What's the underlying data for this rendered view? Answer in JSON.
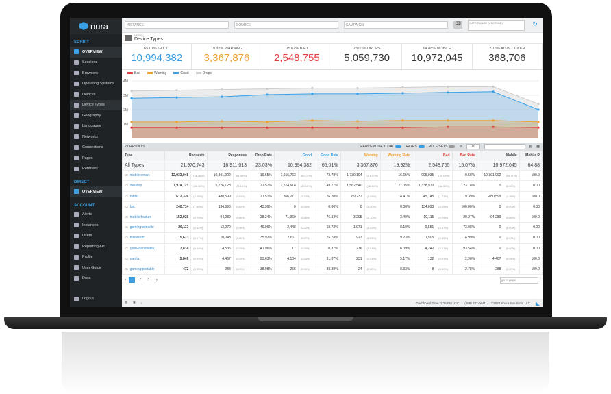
{
  "logo": {
    "text": "nura"
  },
  "sidebar": {
    "script_label": "SCRIPT",
    "script_items": [
      {
        "label": "OVERVIEW",
        "icon": "dashboard-icon",
        "active": true
      },
      {
        "label": "Sessions",
        "icon": "sessions-icon"
      },
      {
        "label": "Browsers",
        "icon": "browser-icon"
      },
      {
        "label": "Operating Systems",
        "icon": "os-icon"
      },
      {
        "label": "Devices",
        "icon": "devices-icon"
      },
      {
        "label": "Device Types",
        "icon": "device-types-icon",
        "selected": true
      },
      {
        "label": "Geography",
        "icon": "globe-icon"
      },
      {
        "label": "Languages",
        "icon": "language-icon"
      },
      {
        "label": "Networks",
        "icon": "network-icon"
      },
      {
        "label": "Connections",
        "icon": "connections-icon"
      },
      {
        "label": "Pages",
        "icon": "pages-icon"
      },
      {
        "label": "Referrers",
        "icon": "referrers-icon"
      }
    ],
    "direct_label": "DIRECT",
    "direct_items": [
      {
        "label": "OVERVIEW",
        "icon": "dashboard-icon",
        "active": true
      }
    ],
    "account_label": "ACCOUNT",
    "account_items": [
      {
        "label": "Alerts",
        "icon": "alerts-icon"
      },
      {
        "label": "Instances",
        "icon": "instances-icon"
      },
      {
        "label": "Users",
        "icon": "users-icon"
      },
      {
        "label": "Reporting API",
        "icon": "api-icon"
      },
      {
        "label": "Profile",
        "icon": "profile-icon"
      },
      {
        "label": "User Guide",
        "icon": "guide-icon"
      },
      {
        "label": "Docs",
        "icon": "docs-icon"
      }
    ],
    "logout": "Logout"
  },
  "filters": {
    "instance": "INSTANCE",
    "source": "SOURCE",
    "campaign": "CAMPAIGN",
    "daterange": "DATE RANGE (UTC TIME)"
  },
  "header": {
    "small": "METRIC",
    "title": "Device Types"
  },
  "stats": [
    {
      "label": "65.01% GOOD",
      "value": "10,994,382",
      "color": "c-good"
    },
    {
      "label": "19.92% WARNING",
      "value": "3,367,876",
      "color": "c-warn"
    },
    {
      "label": "15.07% BAD",
      "value": "2,548,755",
      "color": "c-bad"
    },
    {
      "label": "23.03% DROPS",
      "value": "5,059,730",
      "color": "c-dark"
    },
    {
      "label": "64.88% MOBILE",
      "value": "10,972,045",
      "color": "c-dark"
    },
    {
      "label": "2.18% AD BLOCKER",
      "value": "368,706",
      "color": "c-dark"
    }
  ],
  "legend": [
    {
      "name": "Bad",
      "color": "#e04040"
    },
    {
      "name": "Warning",
      "color": "#f0a030"
    },
    {
      "name": "Good",
      "color": "#3aa0e6"
    },
    {
      "name": "Drops",
      "color": "#cccccc"
    }
  ],
  "chart_data": {
    "type": "area",
    "yticks": [
      "4M",
      "3M",
      "2M",
      "1M"
    ],
    "ylim": [
      0,
      4000000
    ],
    "series": [
      {
        "name": "Drops",
        "color": "#cccccc",
        "values": [
          3300000,
          3350000,
          3400000,
          3450000,
          3500000,
          3500000,
          3550000,
          3600000,
          3600000,
          2400000
        ]
      },
      {
        "name": "Good",
        "color": "#3aa0e6",
        "values": [
          2800000,
          2850000,
          2900000,
          3050000,
          3100000,
          3100000,
          3150000,
          3200000,
          3250000,
          2000000
        ]
      },
      {
        "name": "Warning",
        "color": "#f0a030",
        "values": [
          1150000,
          1150000,
          1200000,
          1150000,
          1250000,
          1200000,
          1250000,
          1250000,
          1250000,
          1150000
        ]
      },
      {
        "name": "Bad",
        "color": "#e04040",
        "values": [
          750000,
          750000,
          750000,
          750000,
          750000,
          750000,
          750000,
          800000,
          800000,
          750000
        ]
      }
    ]
  },
  "toolbar": {
    "results": "21 RESULTS",
    "percent": "PERCENT OF TOTAL",
    "rates": "RATES",
    "rulesets": "RULE SETS",
    "pagesize": "10"
  },
  "table": {
    "headers": [
      "Type",
      "Requests",
      "Responses",
      "Drop Rate",
      "Good",
      "Good Rate",
      "Warning",
      "Warning Rate",
      "Bad",
      "Bad Rate",
      "Mobile",
      "Mobile R"
    ],
    "all": [
      "All Types",
      "21,970,743",
      "16,911,013",
      "23.03%",
      "10,994,382",
      "65.01%",
      "3,367,876",
      "19.92%",
      "2,548,755",
      "15.07%",
      "10,972,045",
      "64.88"
    ],
    "rows": [
      {
        "icon": "mobile-icon",
        "name": "mobile:smart",
        "req": "12,933,048",
        "reqp": "(58.86%)",
        "resp": "10,391,992",
        "respp": "(61.45%)",
        "drop": "19.65%",
        "good": "7,666,763",
        "goodp": "(69.73%)",
        "goodr": "73.78%",
        "warn": "1,730,194",
        "warnp": "(51.37%)",
        "warnr": "16.65%",
        "bad": "995,035",
        "badp": "(39.04%)",
        "badr": "9.58%",
        "mob": "10,391,992",
        "mobp": "(94.71%)",
        "mobr": "100.0"
      },
      {
        "icon": "desktop-icon",
        "name": "desktop",
        "req": "7,974,721",
        "reqp": "(36.30%)",
        "resp": "5,776,128",
        "respp": "(34.16%)",
        "drop": "27.57%",
        "good": "2,874,618",
        "goodp": "(26.15%)",
        "goodr": "49.77%",
        "warn": "1,562,540",
        "warnp": "(46.40%)",
        "warnr": "27.05%",
        "bad": "1,338,970",
        "badp": "(52.53%)",
        "badr": "23.18%",
        "mob": "0",
        "mobp": "(0.00%)",
        "mobr": "0.00"
      },
      {
        "icon": "tablet-icon",
        "name": "tablet",
        "req": "612,326",
        "reqp": "(2.79%)",
        "resp": "480,599",
        "respp": "(2.84%)",
        "drop": "21.51%",
        "good": "366,217",
        "goodp": "(3.33%)",
        "goodr": "76.20%",
        "warn": "69,237",
        "warnp": "(2.06%)",
        "warnr": "14.41%",
        "bad": "45,145",
        "badp": "(1.77%)",
        "badr": "9.39%",
        "mob": "480,599",
        "mobp": "(4.38%)",
        "mobr": "100.0"
      },
      {
        "icon": "bot-icon",
        "name": "bot",
        "req": "240,714",
        "reqp": "(1.10%)",
        "resp": "134,893",
        "respp": "(0.80%)",
        "drop": "43.96%",
        "good": "0",
        "goodp": "(0.00%)",
        "goodr": "0.00%",
        "warn": "0",
        "warnp": "(0.00%)",
        "warnr": "0.00%",
        "bad": "134,893",
        "badp": "(5.29%)",
        "badr": "100.00%",
        "mob": "0",
        "mobp": "(0.00%)",
        "mobr": "0.00"
      },
      {
        "icon": "mobile-icon",
        "name": "mobile:feature",
        "req": "152,928",
        "reqp": "(0.70%)",
        "resp": "94,289",
        "respp": "(0.56%)",
        "drop": "38.34%",
        "good": "71,969",
        "goodp": "(0.65%)",
        "goodr": "76.33%",
        "warn": "3,205",
        "warnp": "(0.10%)",
        "warnr": "3.40%",
        "bad": "19,115",
        "badp": "(0.75%)",
        "badr": "20.27%",
        "mob": "94,289",
        "mobp": "(0.86%)",
        "mobr": "100.0"
      },
      {
        "icon": "gamepad-icon",
        "name": "gaming:console",
        "req": "26,117",
        "reqp": "(0.12%)",
        "resp": "13,070",
        "respp": "(0.08%)",
        "drop": "49.96%",
        "good": "2,448",
        "goodp": "(0.02%)",
        "goodr": "18.73%",
        "warn": "1,071",
        "warnp": "(0.03%)",
        "warnr": "8.19%",
        "bad": "9,551",
        "badp": "(0.37%)",
        "badr": "73.08%",
        "mob": "0",
        "mobp": "(0.00%)",
        "mobr": "0.00"
      },
      {
        "icon": "tv-icon",
        "name": "television",
        "req": "15,673",
        "reqp": "(0.07%)",
        "resp": "10,043",
        "respp": "(0.06%)",
        "drop": "35.92%",
        "good": "7,611",
        "goodp": "(0.07%)",
        "goodr": "75.78%",
        "warn": "927",
        "warnp": "(0.03%)",
        "warnr": "9.23%",
        "bad": "1,505",
        "badp": "(0.06%)",
        "badr": "14.99%",
        "mob": "0",
        "mobp": "(0.00%)",
        "mobr": "0.00"
      },
      {
        "icon": "desktop-icon",
        "name": "(non-identifiable)",
        "req": "7,814",
        "reqp": "(0.04%)",
        "resp": "4,535",
        "respp": "(0.03%)",
        "drop": "41.96%",
        "good": "17",
        "goodp": "(0.00%)",
        "goodr": "0.37%",
        "warn": "276",
        "warnp": "(0.01%)",
        "warnr": "6.09%",
        "bad": "4,242",
        "badp": "(0.17%)",
        "badr": "93.54%",
        "mob": "0",
        "mobp": "(0.00%)",
        "mobr": "0.00"
      },
      {
        "icon": "media-icon",
        "name": "media",
        "req": "5,849",
        "reqp": "(0.03%)",
        "resp": "4,467",
        "respp": "(0.03%)",
        "drop": "23.63%",
        "good": "4,104",
        "goodp": "(0.04%)",
        "goodr": "91.87%",
        "warn": "231",
        "warnp": "(0.01%)",
        "warnr": "5.17%",
        "bad": "132",
        "badp": "(0.01%)",
        "badr": "2.96%",
        "mob": "4,467",
        "mobp": "(0.04%)",
        "mobr": "100.0"
      },
      {
        "icon": "gamepad-icon",
        "name": "gaming:portable",
        "req": "472",
        "reqp": "(0.00%)",
        "resp": "288",
        "respp": "(0.00%)",
        "drop": "38.98%",
        "good": "256",
        "goodp": "(0.00%)",
        "goodr": "88.89%",
        "warn": "24",
        "warnp": "(0.00%)",
        "warnr": "8.33%",
        "bad": "8",
        "badp": "(0.00%)",
        "badr": "2.78%",
        "mob": "288",
        "mobp": "(0.00%)",
        "mobr": "100.0"
      }
    ]
  },
  "pager": {
    "pages": [
      "1",
      "2",
      "3"
    ],
    "goto": "go to page"
  },
  "footer": {
    "time": "Dashboard Time: 2:26 PM UTC",
    "phone": "(888) 337-0641",
    "copy": "©2020 Anura Solutions, LLC"
  }
}
